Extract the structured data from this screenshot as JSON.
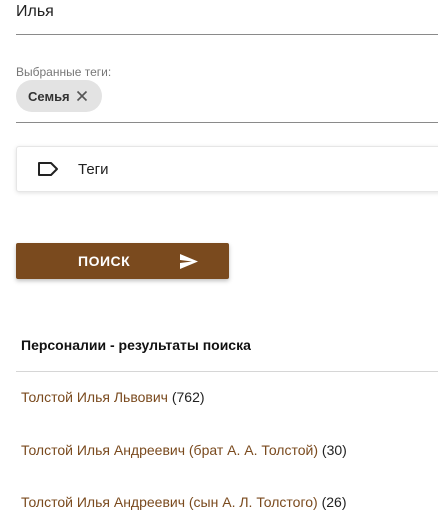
{
  "name_field": {
    "value": "Илья"
  },
  "selected_tags": {
    "label": "Выбранные теги:",
    "chips": [
      {
        "label": "Семья",
        "remove_icon": "close-icon"
      }
    ]
  },
  "tags_input": {
    "icon": "label-tag-icon",
    "label": "Теги"
  },
  "search_button": {
    "label": "ПОИСК",
    "icon": "send-icon"
  },
  "results": {
    "title": "Персоналии - результаты поиска",
    "items": [
      {
        "name": "Толстой Илья Львович",
        "count": "(762)"
      },
      {
        "name": "Толстой Илья Андреевич (брат А. А. Толстой)",
        "count": "(30)"
      },
      {
        "name": "Толстой Илья Андреевич (сын А. Л. Толстого)",
        "count": "(26)"
      }
    ]
  },
  "colors": {
    "accent": "#7a4a1e",
    "link": "#7a4a1e",
    "chip_bg": "#e3e3e3"
  }
}
